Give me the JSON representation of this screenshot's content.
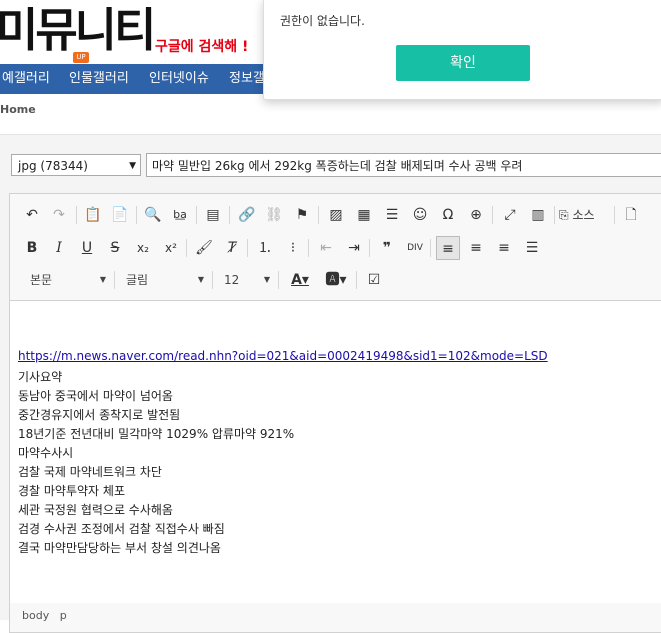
{
  "header": {
    "logo": "미뮤니티",
    "logo_badge": "UP",
    "slogan": "구글에 검색해 !"
  },
  "nav": {
    "items": [
      "예갤러리",
      "인물갤러리",
      "인터넷이슈",
      "정보갤"
    ]
  },
  "breadcrumb": "Home",
  "form": {
    "type_select": "jpg (78344)",
    "title": "마약 밀반입 26kg 에서 292kg 폭증하는데 검찰 배제되며 수사 공백 우려"
  },
  "toolbar": {
    "source_label": "소스",
    "format_combo": "본문",
    "font_combo": "글림",
    "size_combo": "12",
    "icons": [
      "undo-icon",
      "redo-icon",
      "paste-icon",
      "paste-text-icon",
      "find-icon",
      "replace-icon",
      "template-icon",
      "link-icon",
      "unlink-icon",
      "anchor-icon",
      "image-icon",
      "table-icon",
      "hr-icon",
      "smiley-icon",
      "special-char-icon",
      "globe-icon",
      "maximize-icon",
      "show-blocks-icon",
      "source-icon",
      "new-page-icon",
      "bold-icon",
      "italic-icon",
      "underline-icon",
      "strike-icon",
      "subscript-icon",
      "superscript-icon",
      "copy-format-icon",
      "remove-format-icon",
      "numbered-list-icon",
      "bulleted-list-icon",
      "outdent-icon",
      "indent-icon",
      "blockquote-icon",
      "div-icon",
      "align-left-icon",
      "align-center-icon",
      "align-right-icon",
      "justify-icon",
      "text-color-icon",
      "bg-color-icon",
      "checkbox-icon"
    ]
  },
  "body": {
    "link": "https://m.news.naver.com/read.nhn?oid=021&aid=0002419498&sid1=102&mode=LSD",
    "lines": [
      "기사요약",
      "동남아 중국에서 마약이 넘어옴",
      "중간경유지에서 종착지로 발전됨",
      "18년기준 전년대비 밀각마약 1029% 압류마약 921%",
      "마약수사시",
      "검찰 국제 마약네트워크 차단",
      "경찰 마약투약자 체포",
      "세관 국정원 협력으로 수사해옴",
      "검경 수사권 조정에서 검찰 직접수사 빠짐",
      "결국 마약만담당하는 부서 창설 의견나옴"
    ]
  },
  "status_path": [
    "body",
    "p"
  ],
  "dialog": {
    "message": "권한이 없습니다.",
    "ok_label": "확인",
    "ok_color": "#17c0a4"
  },
  "colors": {
    "nav_bg": "#2e62a9",
    "slogan": "#e50012",
    "badge": "#f36b1c"
  }
}
